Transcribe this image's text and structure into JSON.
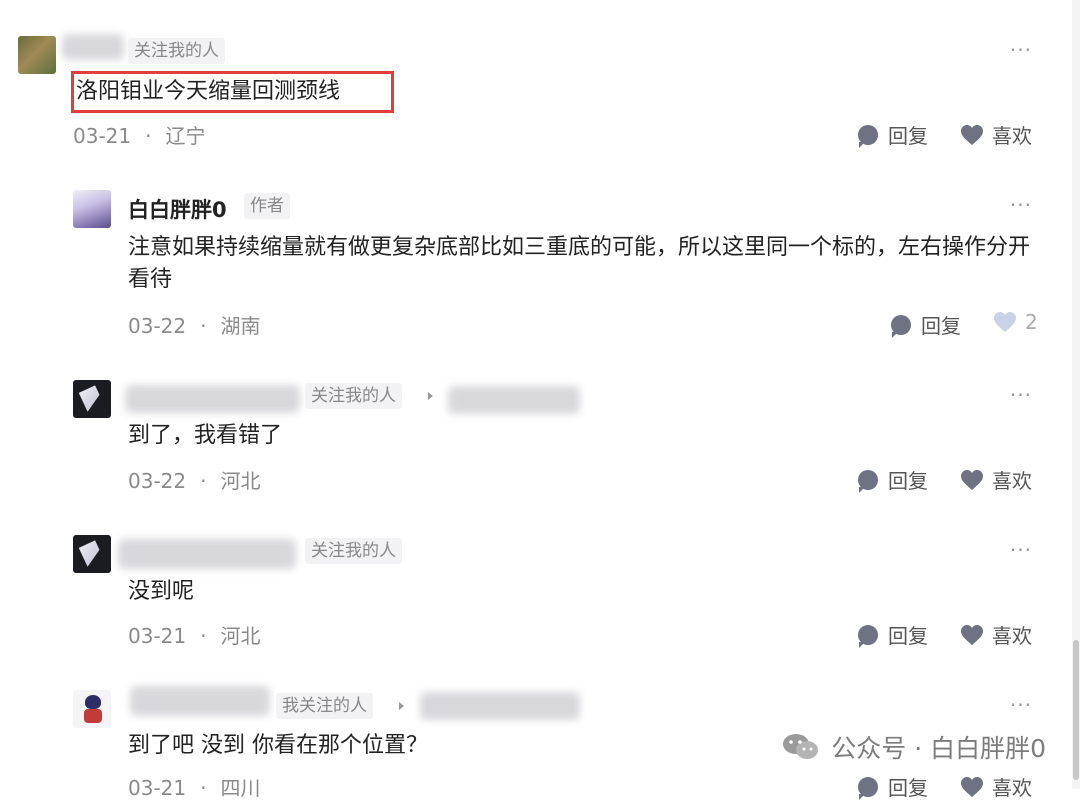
{
  "comments": [
    {
      "tag": "关注我的人",
      "text": "洛阳钼业今天缩量回测颈线",
      "date": "03-21",
      "location": "辽宁",
      "reply": "回复",
      "like": "喜欢",
      "more": "···"
    },
    {
      "name": "白白胖胖0",
      "tag": "作者",
      "text": "注意如果持续缩量就有做更复杂底部比如三重底的可能，所以这里同一个标的，左右操作分开看待",
      "date": "03-22",
      "location": "湖南",
      "reply": "回复",
      "like_count": "2",
      "more": "···"
    },
    {
      "tag": "关注我的人",
      "text": "到了，我看错了",
      "date": "03-22",
      "location": "河北",
      "reply": "回复",
      "like": "喜欢",
      "more": "···"
    },
    {
      "tag": "关注我的人",
      "text": "没到呢",
      "date": "03-21",
      "location": "河北",
      "reply": "回复",
      "like": "喜欢",
      "more": "···"
    },
    {
      "tag": "我关注的人",
      "text": "到了吧 没到 你看在那个位置？",
      "date": "03-21",
      "location": "四川",
      "reply": "回复",
      "like": "喜欢",
      "more": "···"
    }
  ],
  "watermark": {
    "text": "公众号 · 白白胖胖0"
  },
  "colors": {
    "highlight": "#e0403c",
    "icon": "#6e7282",
    "muted": "#8a8a8a"
  }
}
